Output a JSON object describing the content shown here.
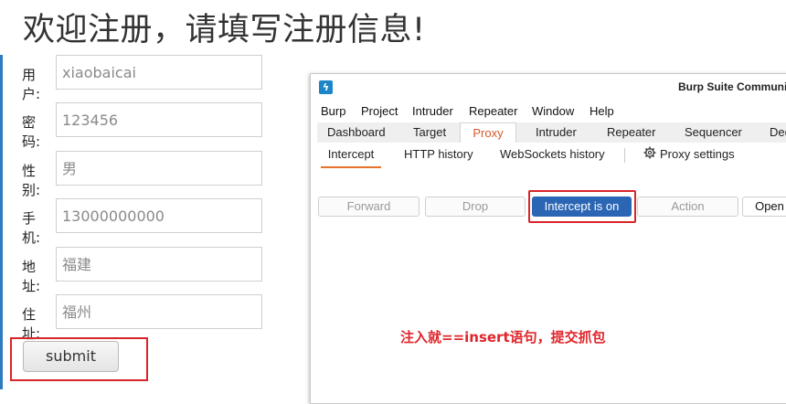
{
  "page_title": "欢迎注册，请填写注册信息!",
  "form": {
    "fields": [
      {
        "label": "用户:",
        "value": "xiaobaicai"
      },
      {
        "label": "密码:",
        "value": "123456"
      },
      {
        "label": "性别:",
        "value": "男"
      },
      {
        "label": "手机:",
        "value": "13000000000"
      },
      {
        "label": "地址:",
        "value": "福建"
      },
      {
        "label": "住址:",
        "value": "福州"
      }
    ],
    "submit_label": "submit"
  },
  "burp": {
    "logo_glyph": "ϟ",
    "title": "Burp Suite Communit",
    "menu": [
      "Burp",
      "Project",
      "Intruder",
      "Repeater",
      "Window",
      "Help"
    ],
    "tabs": [
      "Dashboard",
      "Target",
      "Proxy",
      "Intruder",
      "Repeater",
      "Sequencer",
      "Dec"
    ],
    "active_tab": "Proxy",
    "subtabs": [
      "Intercept",
      "HTTP history",
      "WebSockets history"
    ],
    "active_subtab": "Intercept",
    "settings_label": "Proxy settings",
    "buttons": {
      "forward": "Forward",
      "drop": "Drop",
      "intercept": "Intercept is on",
      "action": "Action",
      "open": "Open"
    },
    "annotation": "注入就==insert语句，提交抓包"
  },
  "colors": {
    "accent_blue": "#2a66b3",
    "highlight_red": "#d9252a",
    "active_orange": "#e8712c"
  }
}
